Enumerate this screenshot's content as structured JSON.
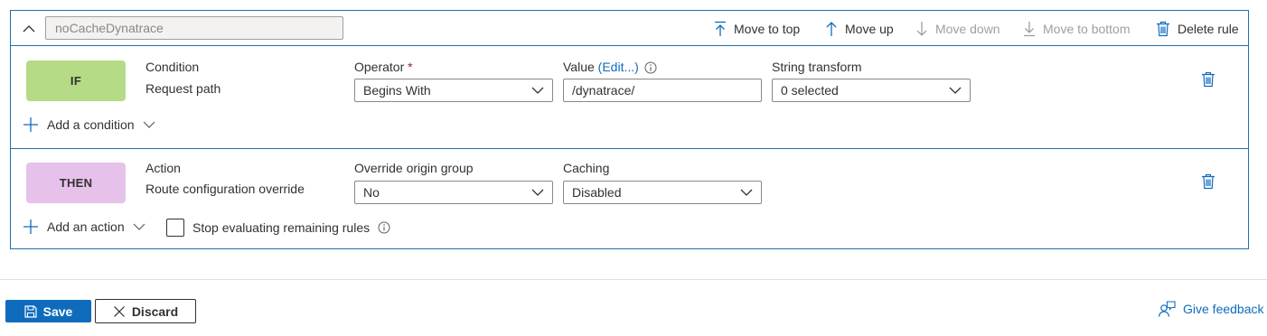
{
  "rule": {
    "name": "noCacheDynatrace",
    "toolbar": {
      "move_to_top": "Move to top",
      "move_up": "Move up",
      "move_down": "Move down",
      "move_to_bottom": "Move to bottom",
      "delete_rule": "Delete rule"
    }
  },
  "if_section": {
    "badge": "IF",
    "condition_label": "Condition",
    "condition_value": "Request path",
    "operator_label": "Operator",
    "operator_required_mark": "*",
    "operator_value": "Begins With",
    "value_label": "Value",
    "value_edit_link": "(Edit...)",
    "value_text": "/dynatrace/",
    "string_transform_label": "String transform",
    "string_transform_value": "0 selected",
    "add_condition": "Add a condition"
  },
  "then_section": {
    "badge": "THEN",
    "action_label": "Action",
    "action_value": "Route configuration override",
    "override_label": "Override origin group",
    "override_value": "No",
    "caching_label": "Caching",
    "caching_value": "Disabled",
    "add_action": "Add an action",
    "stop_evaluating": "Stop evaluating remaining rules"
  },
  "footer": {
    "save": "Save",
    "discard": "Discard",
    "give_feedback": "Give feedback"
  },
  "colors": {
    "accent": "#0f6cbd",
    "card_border": "#1f6fab",
    "if_badge": "#b5db86",
    "then_badge": "#e6c1ea",
    "disabled_text": "#a19f9d",
    "required": "#a4262c"
  }
}
